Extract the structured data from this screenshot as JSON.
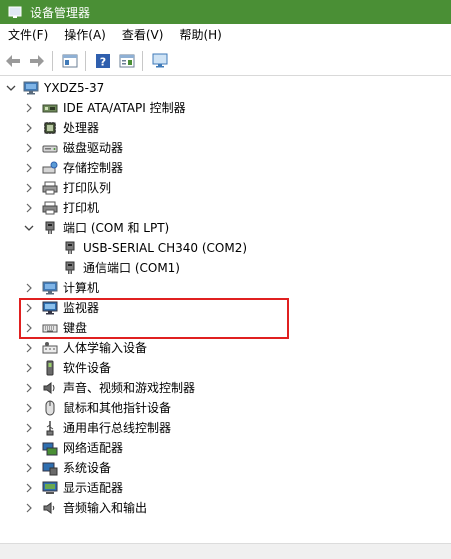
{
  "window": {
    "title": "设备管理器"
  },
  "menu": {
    "file": "文件(F)",
    "action": "操作(A)",
    "view": "查看(V)",
    "help": "帮助(H)"
  },
  "tree": {
    "root": "YXDZ5-37",
    "categories": [
      {
        "label": "IDE ATA/ATAPI 控制器",
        "icon": "ide-controller-icon"
      },
      {
        "label": "处理器",
        "icon": "processor-icon"
      },
      {
        "label": "磁盘驱动器",
        "icon": "disk-drive-icon"
      },
      {
        "label": "存储控制器",
        "icon": "storage-controller-icon"
      },
      {
        "label": "打印队列",
        "icon": "print-queue-icon"
      },
      {
        "label": "打印机",
        "icon": "printer-icon"
      },
      {
        "label": "端口 (COM 和 LPT)",
        "icon": "port-icon",
        "expanded": true,
        "children": [
          {
            "label": "USB-SERIAL CH340 (COM2)",
            "icon": "port-icon"
          },
          {
            "label": "通信端口 (COM1)",
            "icon": "port-icon"
          }
        ]
      },
      {
        "label": "计算机",
        "icon": "computer-icon"
      },
      {
        "label": "监视器",
        "icon": "monitor-icon"
      },
      {
        "label": "键盘",
        "icon": "keyboard-icon"
      },
      {
        "label": "人体学输入设备",
        "icon": "hid-icon"
      },
      {
        "label": "软件设备",
        "icon": "software-device-icon"
      },
      {
        "label": "声音、视频和游戏控制器",
        "icon": "sound-icon"
      },
      {
        "label": "鼠标和其他指针设备",
        "icon": "mouse-icon"
      },
      {
        "label": "通用串行总线控制器",
        "icon": "usb-controller-icon"
      },
      {
        "label": "网络适配器",
        "icon": "network-adapter-icon"
      },
      {
        "label": "系统设备",
        "icon": "system-device-icon"
      },
      {
        "label": "显示适配器",
        "icon": "display-adapter-icon"
      },
      {
        "label": "音频输入和输出",
        "icon": "audio-io-icon"
      }
    ]
  },
  "colors": {
    "titlebar": "#4a8f35",
    "highlight": "#e02020"
  }
}
